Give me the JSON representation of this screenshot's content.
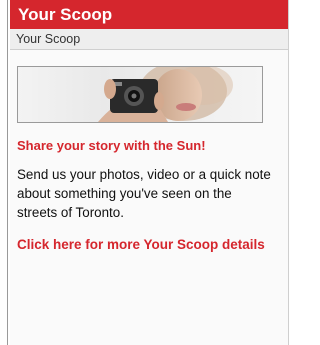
{
  "widget": {
    "header_title": "Your Scoop",
    "subheader": "Your Scoop",
    "cta_title": "Share your story with the Sun!",
    "description": "Send us your photos, video or a quick note about something you've seen on the streets of Toronto.",
    "details_link": "Click here for more Your Scoop details"
  },
  "colors": {
    "brand_red": "#d5262d",
    "subheader_bg": "#eeeeee",
    "panel_bg": "#fafafa"
  },
  "icons": {
    "banner_image": "woman-with-camera-image"
  }
}
